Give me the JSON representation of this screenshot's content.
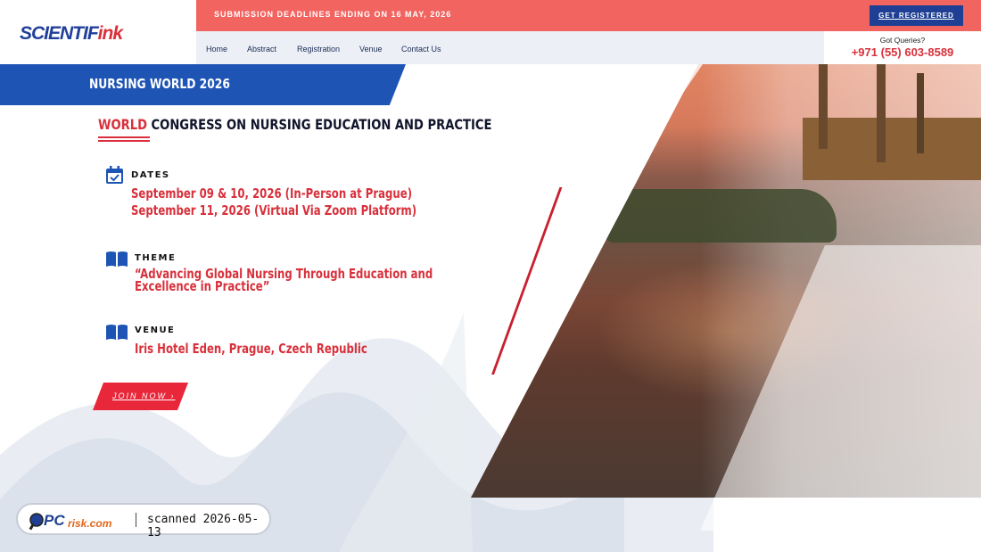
{
  "brand": {
    "logo_text": "SCIENTIF",
    "logo_accent": "ink"
  },
  "topbar": {
    "deadline": "SUBMISSION DEADLINES ENDING ON 16 MAY, 2026",
    "cta": "GET REGISTERED"
  },
  "nav": {
    "items": [
      {
        "label": "Home"
      },
      {
        "label": "Abstract"
      },
      {
        "label": "Registration"
      },
      {
        "label": "Venue"
      },
      {
        "label": "Contact Us"
      }
    ]
  },
  "contact": {
    "label": "Got Queries?",
    "phone": "+971 (55) 603-8589"
  },
  "hero": {
    "event_name": "NURSING WORLD 2026",
    "title_accent": "WORLD",
    "title_rest": " CONGRESS ON NURSING EDUCATION AND PRACTICE"
  },
  "sections": {
    "dates": {
      "label": "DATES",
      "line1": "September 09 & 10, 2026 (In-Person at Prague)",
      "line2": "September 11, 2026 (Virtual Via Zoom Platform)"
    },
    "theme": {
      "label": "THEME",
      "line1": "“Advancing Global Nursing Through Education and",
      "line2": "Excellence in Practice”"
    },
    "venue": {
      "label": "VENUE",
      "line1": "Iris Hotel Eden, Prague, Czech Republic"
    }
  },
  "join": {
    "label": "JOIN NOW ›"
  },
  "watermark": {
    "brand": "PCrisk.com",
    "text": "scanned 2026-05-13"
  },
  "colors": {
    "accent_red": "#d8303b",
    "brand_blue": "#1e55b4",
    "topbar": "#f26460"
  },
  "icons": {
    "dates": "calendar-check-icon",
    "theme": "open-book-icon",
    "venue": "open-book-icon"
  }
}
